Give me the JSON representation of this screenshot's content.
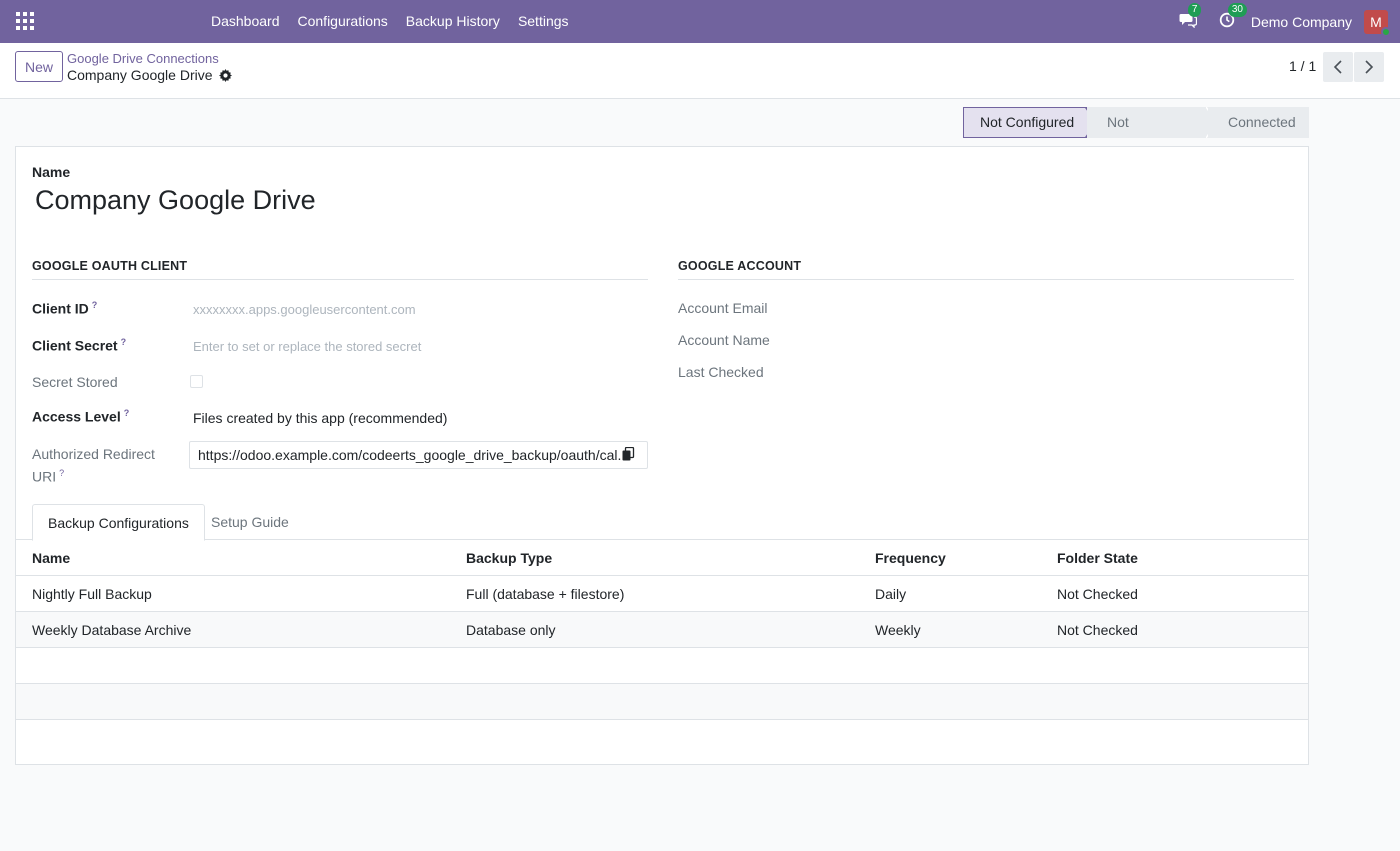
{
  "navbar": {
    "menu": [
      "Dashboard",
      "Configurations",
      "Backup History",
      "Settings"
    ],
    "messages_count": "7",
    "activities_count": "30",
    "company": "Demo Company",
    "avatar_initial": "M"
  },
  "control_panel": {
    "new_label": "New",
    "breadcrumb": "Google Drive Connections",
    "record_title": "Company Google Drive",
    "pager": "1 / 1"
  },
  "status": {
    "stages": [
      "Not Configured",
      "Not Authorized",
      "Connected"
    ],
    "active": "Not Configured"
  },
  "form": {
    "name_label": "Name",
    "name_value": "Company Google Drive",
    "oauth_title": "GOOGLE OAUTH CLIENT",
    "account_title": "GOOGLE ACCOUNT",
    "client_id_label": "Client ID",
    "client_id_placeholder": "xxxxxxxx.apps.googleusercontent.com",
    "client_secret_label": "Client Secret",
    "client_secret_placeholder": "Enter to set or replace the stored secret",
    "secret_stored_label": "Secret Stored",
    "access_level_label": "Access Level",
    "access_level_value": "Files created by this app (recommended)",
    "redirect_label_1": "Authorized Redirect",
    "redirect_label_2": "URI",
    "redirect_value": "https://odoo.example.com/codeerts_google_drive_backup/oauth/cal...",
    "account_email_label": "Account Email",
    "account_name_label": "Account Name",
    "last_checked_label": "Last Checked",
    "help_mark": "?"
  },
  "tabs": [
    "Backup Configurations",
    "Setup Guide"
  ],
  "table": {
    "headers": [
      "Name",
      "Backup Type",
      "Frequency",
      "Folder State"
    ],
    "rows": [
      [
        "Nightly Full Backup",
        "Full (database + filestore)",
        "Daily",
        "Not Checked"
      ],
      [
        "Weekly Database Archive",
        "Database only",
        "Weekly",
        "Not Checked"
      ]
    ]
  }
}
